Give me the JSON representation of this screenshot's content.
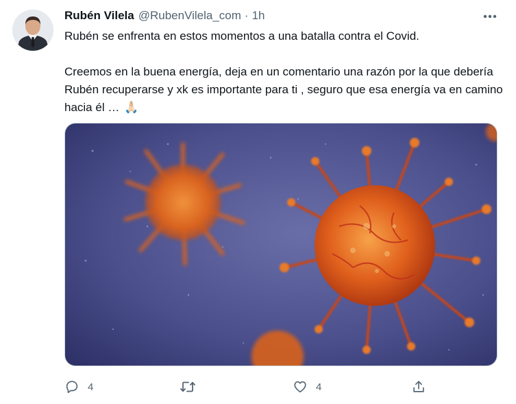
{
  "tweet": {
    "author_name": "Rubén Vilela",
    "handle": "@RubenVilela_com",
    "separator": "·",
    "time": "1h",
    "paragraph1": "Rubén se enfrenta en estos momentos a una batalla contra el Covid.",
    "paragraph2": "Creemos en la buena energía, deja en un comentario una razón por la que debería Rubén recuperarse y xk es importante para ti , seguro que esa energía va en camino hacia él …",
    "emoji": "🙏🏻"
  },
  "actions": {
    "reply_count": "4",
    "retweet_count": "",
    "like_count": "4"
  },
  "icons": {
    "more": "more-horizontal-icon",
    "reply": "reply-icon",
    "retweet": "retweet-icon",
    "like": "heart-icon",
    "share": "share-icon"
  },
  "colors": {
    "text_primary": "#0f1419",
    "text_secondary": "#536471",
    "media_background": "#4a4f8a",
    "virus_orange": "#e8641c"
  }
}
